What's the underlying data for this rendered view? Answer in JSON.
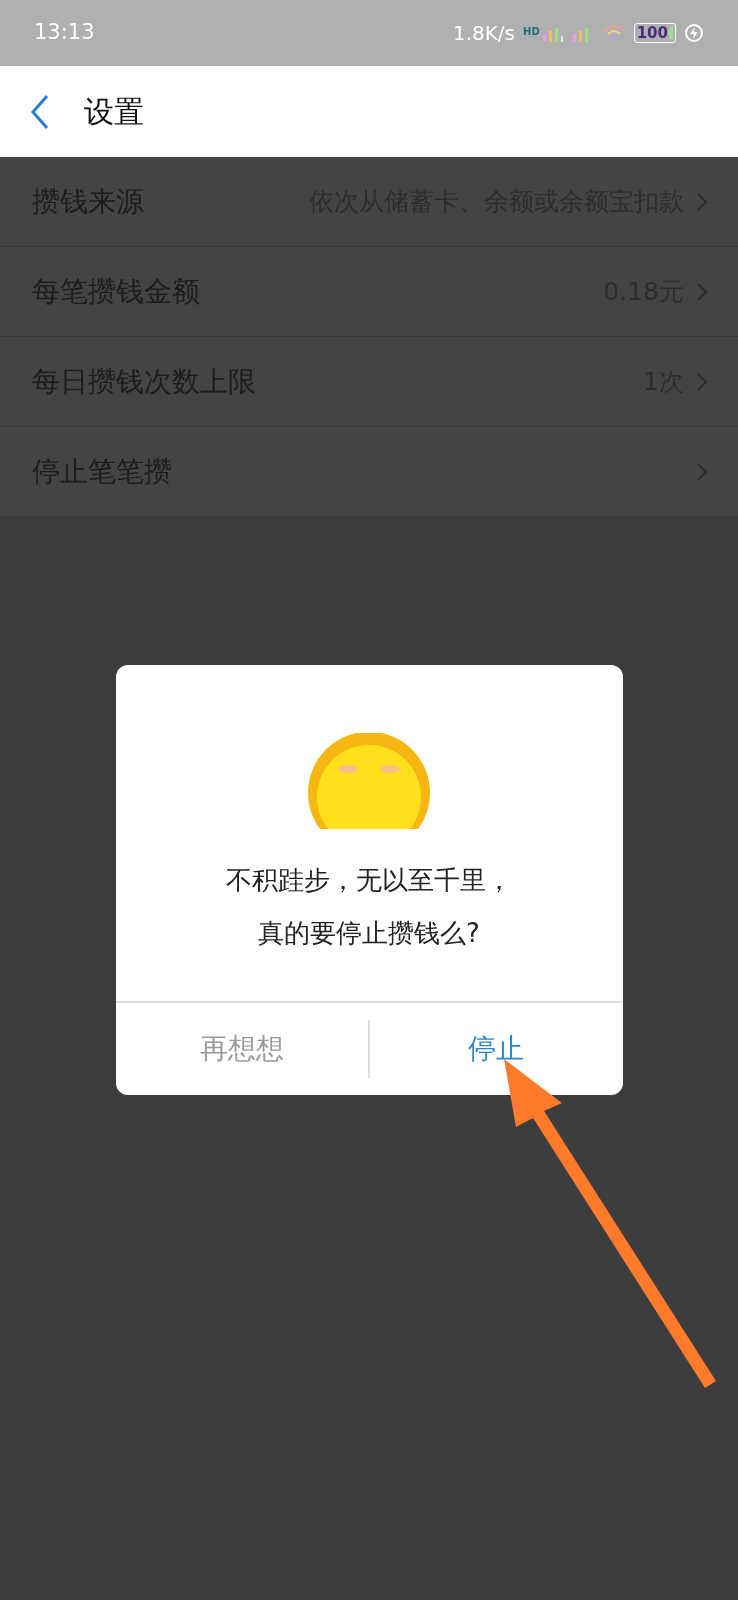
{
  "status_bar": {
    "time": "13:13",
    "speed": "1.8K/s",
    "network_badge": "HD",
    "battery": "100"
  },
  "header": {
    "title": "设置"
  },
  "settings": [
    {
      "label": "攒钱来源",
      "value": "依次从储蓄卡、余额或余额宝扣款"
    },
    {
      "label": "每笔攒钱金额",
      "value": "0.18元"
    },
    {
      "label": "每日攒钱次数上限",
      "value": "1次"
    },
    {
      "label": "停止笔笔攒"
    }
  ],
  "dialog": {
    "message": [
      "不积跬步，无以至千里，",
      "真的要停止攒钱么?"
    ],
    "buttons": [
      {
        "label": "再想想",
        "kind": "cancel"
      },
      {
        "label": "停止",
        "kind": "confirm"
      }
    ]
  }
}
